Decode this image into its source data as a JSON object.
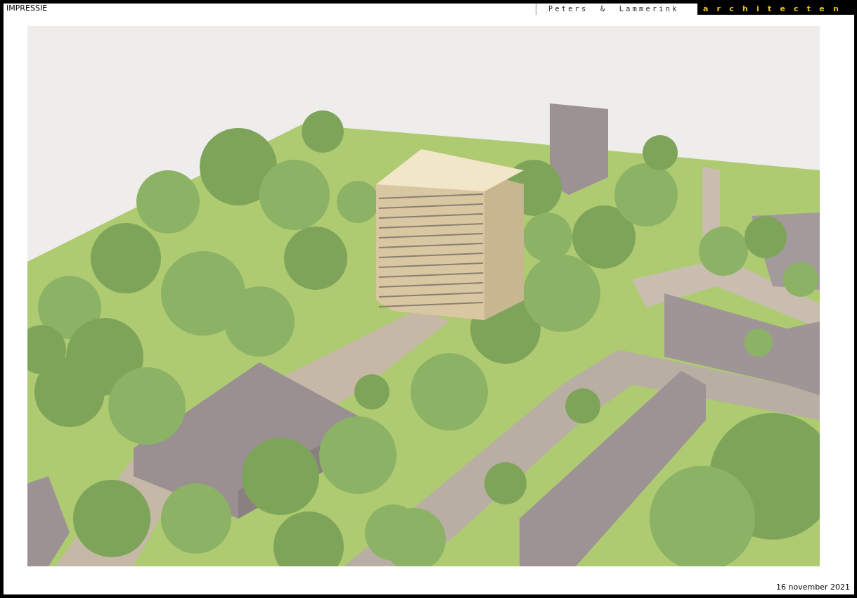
{
  "header": {
    "title": "IMPRESSIE",
    "logo": {
      "name": "Peters & Lammerink",
      "tagline": "architecten"
    }
  },
  "footer": {
    "date": "16 november 2021"
  }
}
